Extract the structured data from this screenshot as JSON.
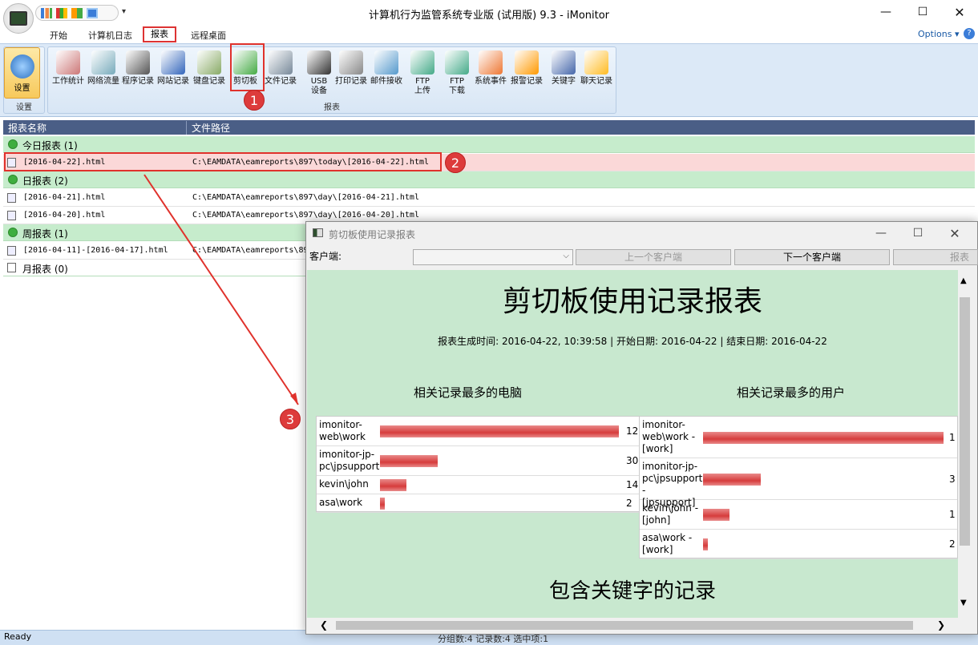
{
  "window": {
    "title": "计算机行为监管系统专业版 (试用版) 9.3 - iMonitor"
  },
  "tabs": [
    "开始",
    "计算机日志",
    "报表",
    "远程桌面"
  ],
  "options_label": "Options",
  "ribbon": {
    "settings_label": "设置",
    "settings_group": "设置",
    "reports_group": "报表",
    "buttons": [
      "工作统计",
      "网络流量",
      "程序记录",
      "网站记录",
      "键盘记录",
      "剪切板",
      "文件记录",
      "USB\n设备",
      "打印记录",
      "邮件接收",
      "FTP\n上传",
      "FTP\n下载",
      "系统事件",
      "报警记录",
      "关键字",
      "聊天记录"
    ]
  },
  "list": {
    "headers": [
      "报表名称",
      "文件路径"
    ],
    "groups": [
      {
        "label": "今日报表 (1)",
        "files": [
          {
            "name": "[2016-04-22].html",
            "path": "C:\\EAMDATA\\eamreports\\897\\today\\[2016-04-22].html"
          }
        ]
      },
      {
        "label": "日报表 (2)",
        "files": [
          {
            "name": "[2016-04-21].html",
            "path": "C:\\EAMDATA\\eamreports\\897\\day\\[2016-04-21].html"
          },
          {
            "name": "[2016-04-20].html",
            "path": "C:\\EAMDATA\\eamreports\\897\\day\\[2016-04-20].html"
          }
        ]
      },
      {
        "label": "周报表 (1)",
        "files": [
          {
            "name": "[2016-04-11]-[2016-04-17].html",
            "path": "C:\\EAMDATA\\eamreports\\89"
          }
        ]
      },
      {
        "label": "月报表 (0)",
        "files": []
      }
    ]
  },
  "badges": [
    "1",
    "2",
    "3"
  ],
  "status": {
    "ready": "Ready",
    "counts": "分组数:4 记录数:4 选中项:1"
  },
  "popup": {
    "title": "剪切板使用记录报表",
    "client_label": "客户端:",
    "prev_client": "上一个客户端",
    "next_client": "下一个客户端",
    "report_btn": "报表",
    "report_title": "剪切板使用记录报表",
    "report_meta": "报表生成时间: 2016-04-22, 10:39:58 | 开始日期: 2016-04-22 | 结束日期: 2016-04-22",
    "computers_heading": "相关记录最多的电脑",
    "users_heading": "相关记录最多的用户",
    "computers": [
      {
        "name": "imonitor-web\\work",
        "value": "12",
        "fraction": 1.0
      },
      {
        "name": "imonitor-jp-pc\\jpsupport",
        "value": "30",
        "fraction": 0.24
      },
      {
        "name": "kevin\\john",
        "value": "14",
        "fraction": 0.11
      },
      {
        "name": "asa\\work",
        "value": "2",
        "fraction": 0.02
      }
    ],
    "users": [
      {
        "name": "imonitor-web\\work - [work]",
        "value": "1",
        "fraction": 1.0
      },
      {
        "name": "imonitor-jp-pc\\jpsupport - [jpsupport]",
        "value": "3",
        "fraction": 0.24
      },
      {
        "name": "kevin\\john - [john]",
        "value": "1",
        "fraction": 0.11
      },
      {
        "name": "asa\\work - [work]",
        "value": "2",
        "fraction": 0.02
      }
    ],
    "keyword_heading": "包含关键字的记录"
  },
  "colors": {
    "accent": "#e0322c",
    "group_bg": "#c6eccc",
    "header_bg": "#4a5e86",
    "report_bg": "#c8e8cf",
    "bar": "#d63c3c"
  }
}
